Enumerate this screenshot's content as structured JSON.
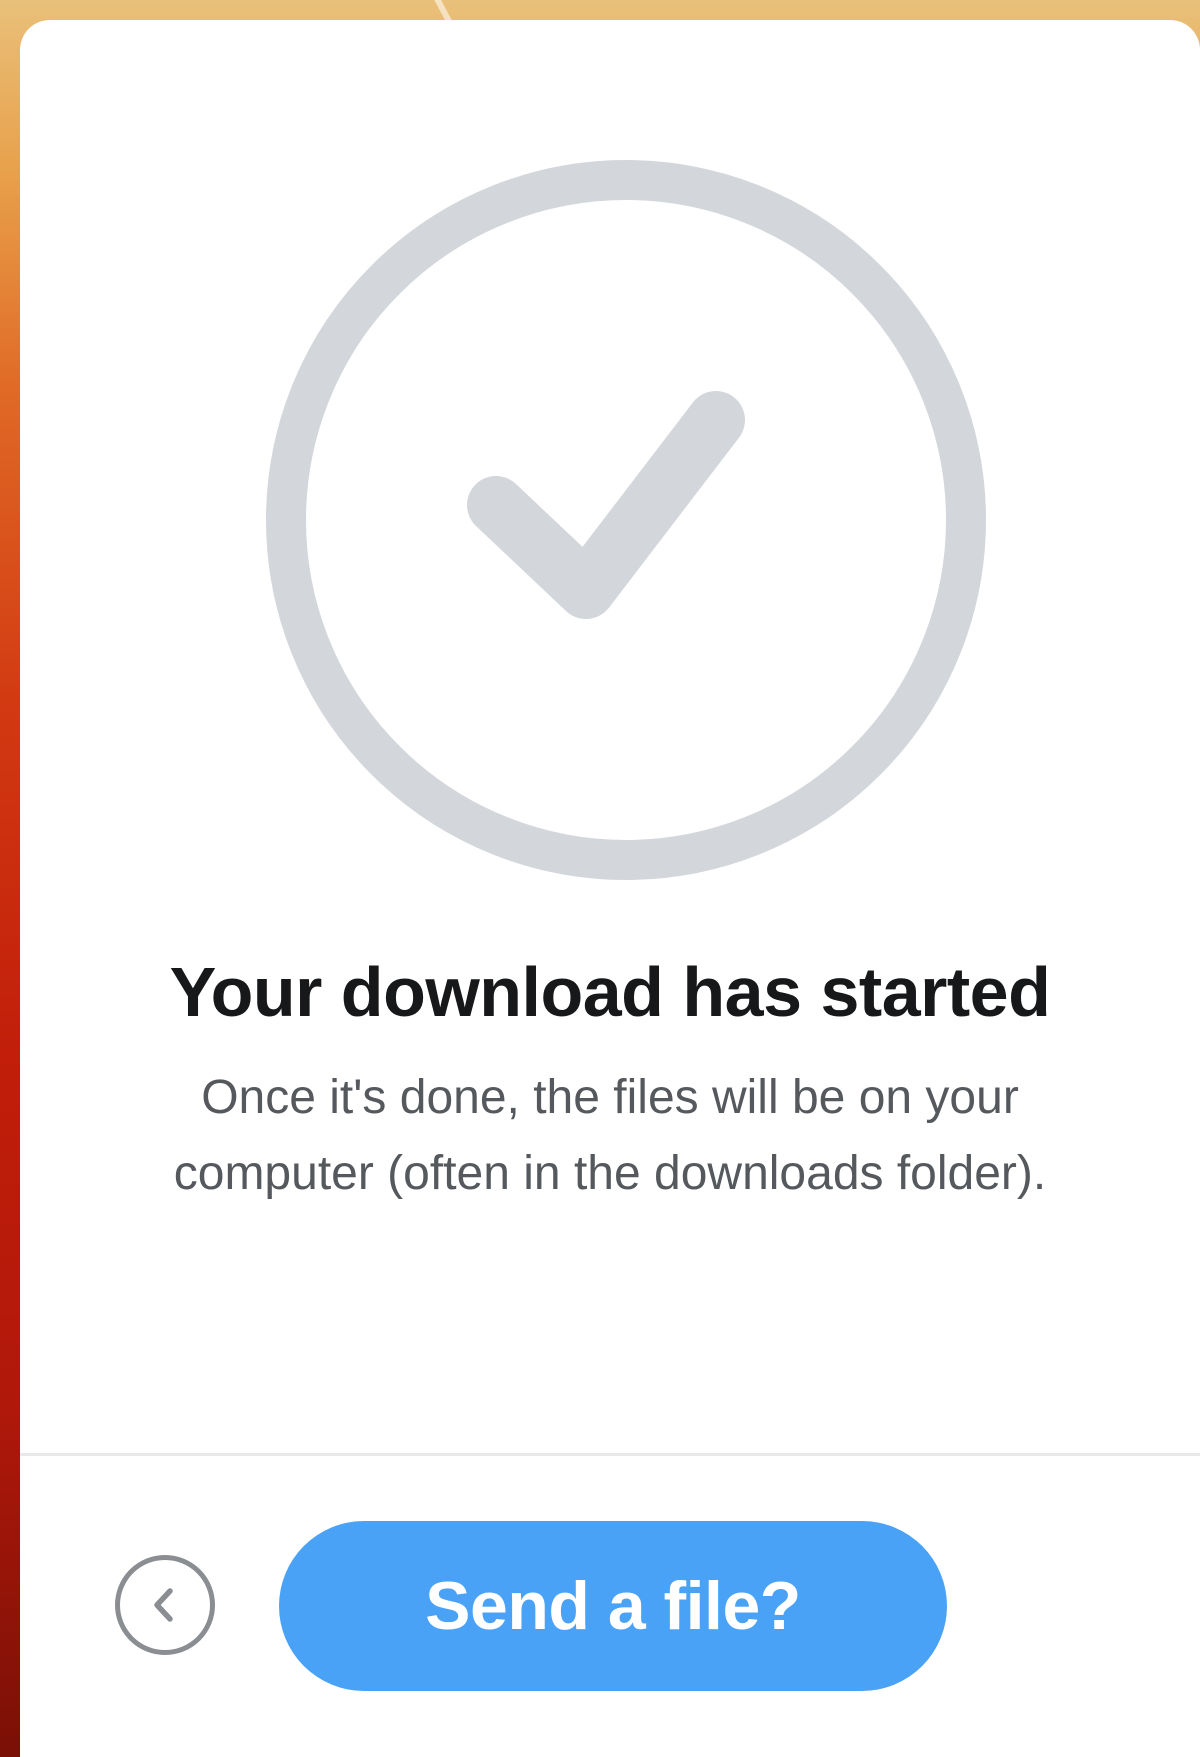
{
  "dialog": {
    "title": "Your download has started",
    "message": "Once it's done, the files will be on your computer (often in the downloads folder).",
    "status_icon": "check-circle-icon"
  },
  "footer": {
    "back_icon": "chevron-left-icon",
    "send_label": "Send a file?"
  },
  "colors": {
    "accent": "#4aa2f7",
    "icon_gray": "#d3d6da",
    "title_text": "#17181a",
    "body_text": "#55595e"
  }
}
